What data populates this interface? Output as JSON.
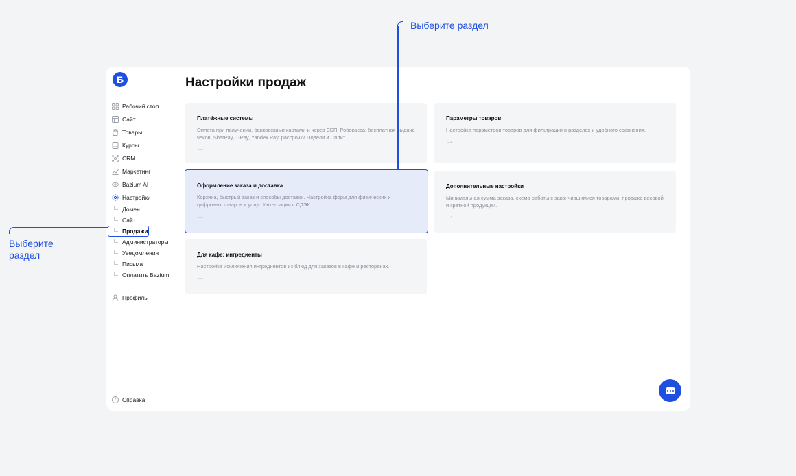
{
  "logo": {
    "letter": "Б"
  },
  "sidebar": {
    "items": [
      {
        "label": "Рабочий стол",
        "icon": "grid-icon"
      },
      {
        "label": "Сайт",
        "icon": "layout-icon"
      },
      {
        "label": "Товары",
        "icon": "bag-icon"
      },
      {
        "label": "Курсы",
        "icon": "book-icon"
      },
      {
        "label": "CRM",
        "icon": "network-icon"
      },
      {
        "label": "Маркетинг",
        "icon": "chart-icon"
      },
      {
        "label": "Bazium AI",
        "icon": "ai-icon"
      },
      {
        "label": "Настройки",
        "icon": "gear-icon"
      }
    ],
    "settings_sub": [
      {
        "label": "Домен"
      },
      {
        "label": "Сайт"
      },
      {
        "label": "Продажи"
      },
      {
        "label": "Администраторы"
      },
      {
        "label": "Уведомления"
      },
      {
        "label": "Письма"
      },
      {
        "label": "Оплатить Bazium"
      }
    ],
    "profile": "Профиль",
    "help": "Справка"
  },
  "page": {
    "title": "Настройки продаж"
  },
  "cards": [
    {
      "title": "Платёжные системы",
      "desc": "Оплата при получении, банковскими картами и через СБП. Робокасса: бесплатная выдача чеков, SberPay, T-Pay, Yandex Pay, рассрочки Подели и Сплит.",
      "arrow": "→"
    },
    {
      "title": "Параметры товаров",
      "desc": "Настройка параметров товаров для фильтрации в разделах и удобного сравнения.",
      "arrow": "→"
    },
    {
      "title": "Оформление заказа и доставка",
      "desc": "Корзина, быстрый заказ и способы доставки. Настройка форм для физических и цифровых товаров и услуг. Интеграция с СДЭК.",
      "arrow": "→"
    },
    {
      "title": "Дополнительные настройки",
      "desc": "Минимальная сумма заказа, схема работы с закончившимися товарами, продажа весовой и кратной продукции.",
      "arrow": "→"
    },
    {
      "title": "Для кафе: ингредиенты",
      "desc": "Настройка исключения ингредиентов из блюд для заказов в кафе и ресторанах.",
      "arrow": "→"
    }
  ],
  "annotations": {
    "top": "Выберите раздел",
    "left_line1": "Выберите",
    "left_line2": "раздел"
  },
  "colors": {
    "accent": "#1f4fe0",
    "card_bg": "#f4f5f7",
    "selected_bg": "#e6ebfa"
  }
}
